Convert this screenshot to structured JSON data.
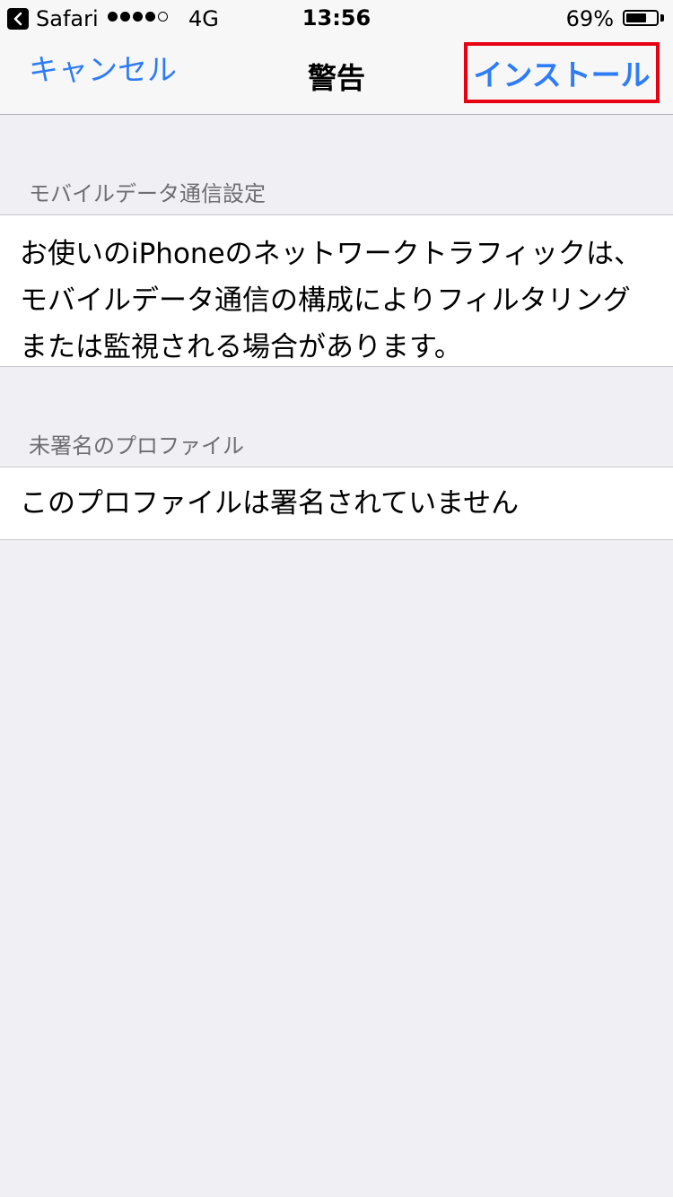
{
  "status_bar": {
    "back_app": "Safari",
    "network": "4G",
    "time": "13:56",
    "battery_percent": "69%",
    "battery_level": 0.69,
    "signal_bars_filled": 4,
    "signal_bars_total": 5
  },
  "nav": {
    "cancel_label": "キャンセル",
    "title": "警告",
    "install_label": "インストール",
    "accent_color": "#2e7cf6",
    "highlight_color": "#e60012"
  },
  "sections": [
    {
      "header": "モバイルデータ通信設定",
      "lines": [
        "お使いのiPhoneのネットワークトラフィックは、",
        "モバイルデータ通信の構成によりフィルタリング",
        "または監視される場合があります。"
      ]
    },
    {
      "header": "未署名のプロファイル",
      "lines": [
        "このプロファイルは署名されていません"
      ]
    }
  ]
}
